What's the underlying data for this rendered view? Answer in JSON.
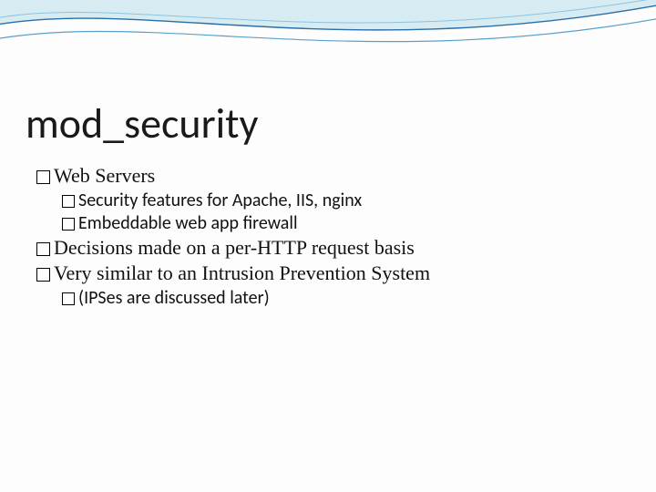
{
  "title": "mod_security",
  "bullets": {
    "web_servers": "Web Servers",
    "security_features": "Security features for Apache, IIS, nginx",
    "embeddable_firewall": "Embeddable web app firewall",
    "decisions": "Decisions made on a per-HTTP request basis",
    "similar_ips": "Very similar to an Intrusion Prevention System",
    "ipses_later": "(IPSes are discussed later)"
  }
}
